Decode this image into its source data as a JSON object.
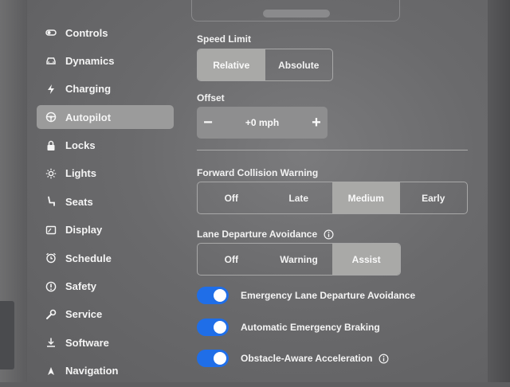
{
  "sidebar": {
    "items": [
      {
        "label": "Controls",
        "icon": "toggle-icon"
      },
      {
        "label": "Dynamics",
        "icon": "car-icon"
      },
      {
        "label": "Charging",
        "icon": "bolt-icon"
      },
      {
        "label": "Autopilot",
        "icon": "steering-wheel-icon",
        "active": true
      },
      {
        "label": "Locks",
        "icon": "lock-icon"
      },
      {
        "label": "Lights",
        "icon": "sun-icon"
      },
      {
        "label": "Seats",
        "icon": "seat-icon"
      },
      {
        "label": "Display",
        "icon": "display-icon"
      },
      {
        "label": "Schedule",
        "icon": "alarm-clock-icon"
      },
      {
        "label": "Safety",
        "icon": "alert-circle-icon"
      },
      {
        "label": "Service",
        "icon": "wrench-icon"
      },
      {
        "label": "Software",
        "icon": "download-icon"
      },
      {
        "label": "Navigation",
        "icon": "navigation-arrow-icon"
      }
    ]
  },
  "speed_limit": {
    "label": "Speed Limit",
    "options": [
      "Relative",
      "Absolute"
    ],
    "selected": "Relative"
  },
  "offset": {
    "label": "Offset",
    "value": "+0 mph",
    "minus": "−",
    "plus": "+"
  },
  "forward_collision_warning": {
    "label": "Forward Collision Warning",
    "options": [
      "Off",
      "Late",
      "Medium",
      "Early"
    ],
    "selected": "Medium"
  },
  "lane_departure_avoidance": {
    "label": "Lane Departure Avoidance",
    "options": [
      "Off",
      "Warning",
      "Assist"
    ],
    "selected": "Assist"
  },
  "toggles": [
    {
      "label": "Emergency Lane Departure Avoidance",
      "on": true
    },
    {
      "label": "Automatic Emergency Braking",
      "on": true
    },
    {
      "label": "Obstacle-Aware Acceleration",
      "on": true,
      "info": true
    }
  ],
  "colors": {
    "toggle_on": "#1f6ee8",
    "selected_segment": "#a9a9a7",
    "active_sidebar": "#9b9b9b"
  }
}
